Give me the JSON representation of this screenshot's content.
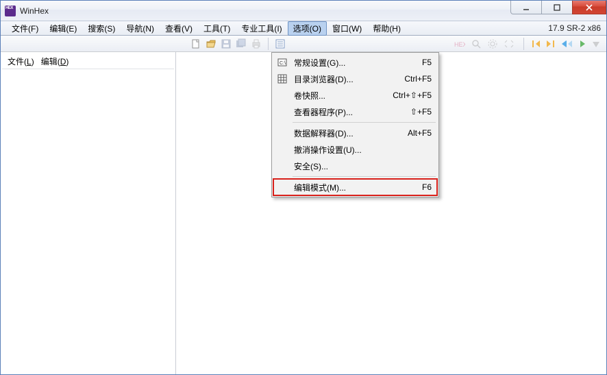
{
  "window": {
    "title": "WinHex",
    "version": "17.9 SR-2 x86"
  },
  "menubar": {
    "items": [
      {
        "label": "文件(F)"
      },
      {
        "label": "编辑(E)"
      },
      {
        "label": "搜索(S)"
      },
      {
        "label": "导航(N)"
      },
      {
        "label": "查看(V)"
      },
      {
        "label": "工具(T)"
      },
      {
        "label": "专业工具(I)"
      },
      {
        "label": "选项(O)",
        "active": true
      },
      {
        "label": "窗口(W)"
      },
      {
        "label": "帮助(H)"
      }
    ]
  },
  "sidepanel": {
    "tabs": [
      {
        "label": "文件",
        "hotkey": "L"
      },
      {
        "label": "编辑",
        "hotkey": "D"
      }
    ]
  },
  "dropdown": {
    "items": [
      {
        "icon": "terminal-icon",
        "label": "常规设置(G)...",
        "shortcut": "F5"
      },
      {
        "icon": "grid-icon",
        "label": "目录浏览器(D)...",
        "shortcut": "Ctrl+F5"
      },
      {
        "icon": "",
        "label": "卷快照...",
        "shortcut": "Ctrl+⇧+F5"
      },
      {
        "icon": "",
        "label": "查看器程序(P)...",
        "shortcut": "⇧+F5"
      },
      {
        "sep": true
      },
      {
        "icon": "",
        "label": "数据解释器(D)...",
        "shortcut": "Alt+F5"
      },
      {
        "icon": "",
        "label": "撤消操作设置(U)...",
        "shortcut": ""
      },
      {
        "icon": "",
        "label": "安全(S)...",
        "shortcut": ""
      },
      {
        "sep": true
      },
      {
        "icon": "",
        "label": "编辑模式(M)...",
        "shortcut": "F6",
        "highlight": true
      }
    ]
  },
  "toolbar": {
    "icons_left": [
      "new-file-icon",
      "open-folder-icon",
      "save-icon",
      "save-all-icon",
      "print-icon"
    ],
    "icons_mid": [
      "properties-icon"
    ],
    "icons_right_dim": [
      "hex-icon",
      "find-icon",
      "settings-icon",
      "expand-icon"
    ],
    "nav_icons": [
      "back-end-icon",
      "fwd-end-icon",
      "back-icon",
      "fwd-icon",
      "down-icon"
    ]
  }
}
